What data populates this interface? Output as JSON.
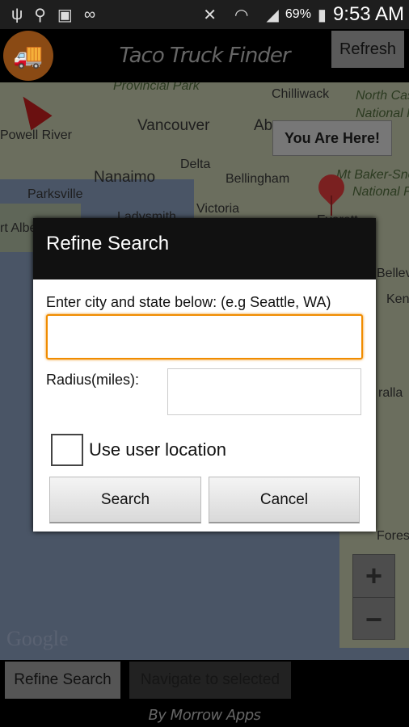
{
  "status_bar": {
    "battery": "69%",
    "time": "9:53 AM",
    "icons": [
      "usb-icon",
      "location-icon",
      "image-icon",
      "voicemail-icon",
      "mute-icon",
      "wifi-icon",
      "signal-icon",
      "battery-charging-icon"
    ]
  },
  "app_bar": {
    "title": "Taco Truck Finder",
    "refresh_label": "Refresh",
    "logo": "taco-truck-logo"
  },
  "map": {
    "labels": [
      "Provincial Park",
      "Chilliwack",
      "North Cas",
      "National P",
      "Powell River",
      "Vancouver",
      "Ab",
      "Delta",
      "Nanaimo",
      "Bellingham",
      "Parksville",
      "Mt Baker-Snoo",
      "National Fo",
      "rt Albe",
      "Ladysmith",
      "Victoria",
      "Everett",
      "Bellev",
      "Ken",
      "ralla",
      "Forest"
    ],
    "marker_callout": "You Are Here!",
    "zoom_in": "+",
    "zoom_out": "−",
    "attribution": "Google"
  },
  "dialog": {
    "title": "Refine Search",
    "city_label": "Enter city and state below: (e.g Seattle, WA)",
    "city_value": "",
    "radius_label": "Radius(miles):",
    "radius_value": "",
    "use_location_label": "Use user location",
    "use_location_checked": false,
    "search_label": "Search",
    "cancel_label": "Cancel",
    "focus_color": "#f08c00"
  },
  "bottom_bar": {
    "refine_label": "Refine Search",
    "navigate_label": "Navigate to selected",
    "navigate_enabled": false,
    "credit": "By Morrow Apps"
  }
}
